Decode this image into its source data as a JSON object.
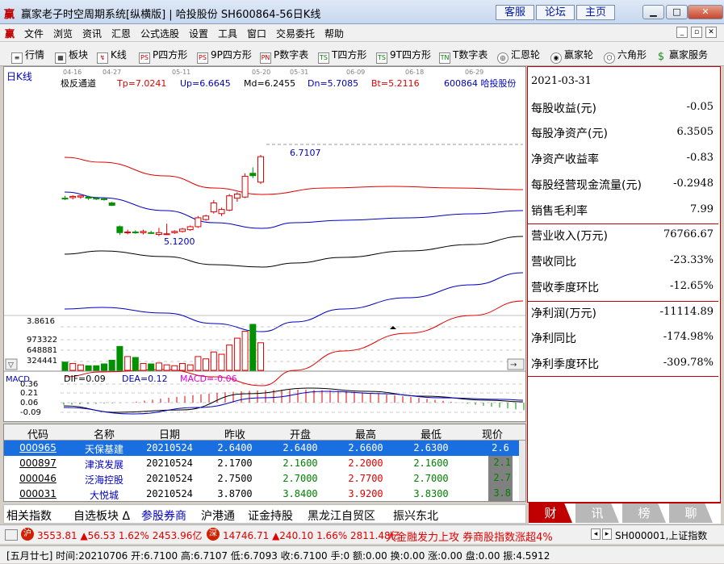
{
  "window": {
    "title": "赢家老子时空周期系统[纵横版] | 哈投股份  SH600864-56日K线",
    "buttons": [
      "客服",
      "论坛",
      "主页"
    ]
  },
  "menu": [
    "文件",
    "浏览",
    "资讯",
    "汇恩",
    "公式选股",
    "设置",
    "工具",
    "窗口",
    "交易委托",
    "帮助"
  ],
  "toolbar": [
    "行情",
    "板块",
    "K线",
    "P四方形",
    "9P四方形",
    "P数字表",
    "T四方形",
    "9T四方形",
    "T数字表",
    "汇恩轮",
    "赢家轮",
    "六角形",
    "赢家服务"
  ],
  "chart": {
    "label": "日K线",
    "indicator": "极反通道",
    "tp": "Tp=7.0241",
    "up": "Up=6.6645",
    "md": "Md=6.2455",
    "dn": "Dn=5.7085",
    "bt": "Bt=5.2116",
    "stock": "600864  哈投股份",
    "dates": [
      "04-16",
      "04-27",
      "05-11",
      "05-20",
      "05-31",
      "06-09",
      "06-18",
      "06-29"
    ],
    "label_high": "6.7107",
    "label_low": "5.1200",
    "vol_labels": [
      "3.8616",
      "973322",
      "648881",
      "324441"
    ],
    "macd": {
      "name": "MACD",
      "dif": "DIF=0.09",
      "dea": "DEA=0.12",
      "macd": "MACD=-0.06",
      "ticks": [
        "0.36",
        "0.21",
        "0.06",
        "-0.09"
      ]
    },
    "candles": [
      {
        "o": 5.98,
        "h": 6.02,
        "l": 5.95,
        "c": 5.97
      },
      {
        "o": 5.99,
        "h": 6.03,
        "l": 5.96,
        "c": 6.01
      },
      {
        "o": 6.0,
        "h": 6.03,
        "l": 5.97,
        "c": 6.02
      },
      {
        "o": 6.0,
        "h": 6.02,
        "l": 5.95,
        "c": 5.98
      },
      {
        "o": 5.98,
        "h": 6.0,
        "l": 5.95,
        "c": 5.97
      },
      {
        "o": 5.97,
        "h": 5.99,
        "l": 5.94,
        "c": 5.96
      },
      {
        "o": 5.9,
        "h": 5.92,
        "l": 5.85,
        "c": 5.86
      },
      {
        "o": 5.5,
        "h": 5.52,
        "l": 5.36,
        "c": 5.4
      },
      {
        "o": 5.4,
        "h": 5.45,
        "l": 5.37,
        "c": 5.41
      },
      {
        "o": 5.41,
        "h": 5.44,
        "l": 5.38,
        "c": 5.4
      },
      {
        "o": 5.4,
        "h": 5.45,
        "l": 5.37,
        "c": 5.42
      },
      {
        "o": 5.4,
        "h": 5.43,
        "l": 5.38,
        "c": 5.39
      },
      {
        "o": 5.37,
        "h": 5.48,
        "l": 5.34,
        "c": 5.4
      },
      {
        "o": 5.37,
        "h": 5.55,
        "l": 5.36,
        "c": 5.38
      },
      {
        "o": 5.4,
        "h": 5.44,
        "l": 5.38,
        "c": 5.42
      },
      {
        "o": 5.42,
        "h": 5.48,
        "l": 5.4,
        "c": 5.46
      },
      {
        "o": 5.45,
        "h": 5.52,
        "l": 5.43,
        "c": 5.5
      },
      {
        "o": 5.5,
        "h": 5.68,
        "l": 5.48,
        "c": 5.65
      },
      {
        "o": 5.62,
        "h": 5.7,
        "l": 5.6,
        "c": 5.68
      },
      {
        "o": 5.75,
        "h": 5.95,
        "l": 5.72,
        "c": 5.9
      },
      {
        "o": 5.72,
        "h": 5.82,
        "l": 5.68,
        "c": 5.79
      },
      {
        "o": 5.78,
        "h": 6.05,
        "l": 5.76,
        "c": 6.02
      },
      {
        "o": 5.98,
        "h": 6.08,
        "l": 5.92,
        "c": 6.05
      },
      {
        "o": 6.0,
        "h": 6.4,
        "l": 5.98,
        "c": 6.35
      },
      {
        "o": 6.4,
        "h": 6.5,
        "l": 6.32,
        "c": 6.36
      },
      {
        "o": 6.25,
        "h": 6.71,
        "l": 6.22,
        "c": 6.68
      }
    ],
    "volumes": [
      0.18,
      0.15,
      0.12,
      0.1,
      0.1,
      0.14,
      0.22,
      0.52,
      0.3,
      0.28,
      0.15,
      0.14,
      0.16,
      0.12,
      0.1,
      0.15,
      0.12,
      0.3,
      0.25,
      0.4,
      0.35,
      0.55,
      0.7,
      0.85,
      1.0,
      0.6
    ]
  },
  "finance": [
    {
      "k": "2021-03-31",
      "v": ""
    },
    {
      "k": "每股收益(元)",
      "v": "-0.05"
    },
    {
      "k": "每股净资产(元)",
      "v": "6.3505"
    },
    {
      "k": "净资产收益率",
      "v": "-0.83"
    },
    {
      "k": "每股经营现金流量(元)",
      "v": "-0.2948"
    },
    {
      "k": "销售毛利率",
      "v": "7.99"
    },
    {
      "k": "营业收入(万元)",
      "v": "76766.67"
    },
    {
      "k": "营收同比",
      "v": "-23.33%"
    },
    {
      "k": "营收季度环比",
      "v": "-12.65%"
    },
    {
      "k": "净利润(万元)",
      "v": "-11114.89"
    },
    {
      "k": "净利同比",
      "v": "-174.98%"
    },
    {
      "k": "净利季度环比",
      "v": "-309.78%"
    }
  ],
  "right_tabs": [
    "财",
    "讯",
    "榜",
    "聊"
  ],
  "table": {
    "headers": [
      "代码",
      "名称",
      "日期",
      "昨收",
      "开盘",
      "最高",
      "最低",
      "现价"
    ],
    "rows": [
      {
        "code": "000965",
        "name": "天保基建",
        "date": "20210524",
        "prev": "2.6400",
        "open": "2.6400",
        "high": "2.6600",
        "low": "2.6300",
        "cur": "2.6"
      },
      {
        "code": "000897",
        "name": "津滨发展",
        "date": "20210524",
        "prev": "2.1700",
        "open": "2.1600",
        "high": "2.2000",
        "low": "2.1600",
        "cur": "2.1"
      },
      {
        "code": "000046",
        "name": "泛海控股",
        "date": "20210524",
        "prev": "2.7500",
        "open": "2.7000",
        "high": "2.7700",
        "low": "2.7000",
        "cur": "2.7"
      },
      {
        "code": "000031",
        "name": "大悦城",
        "date": "20210524",
        "prev": "3.8700",
        "open": "3.8400",
        "high": "3.9200",
        "low": "3.8300",
        "cur": "3.8"
      }
    ]
  },
  "sectors": [
    "相关指数",
    "自选板块 Δ",
    "参股券商",
    "沪港通",
    "证金持股",
    "黑龙江自贸区",
    "振兴东北"
  ],
  "status1": {
    "sh": "3553.81 ▲56.53 1.62% 2453.96亿",
    "sz": "14746.71 ▲240.10 1.66% 2811.48亿",
    "news": "大金融发力上攻 券商股指数涨超4%",
    "code": "SH000001,上证指数"
  },
  "status2": "[五月廿七] 时间:20210706 开:6.7100 高:6.7107 低:6.7093 收:6.7100 手:0 额:0.00 换:0.00 涨:0.00 盘:0.00 振:4.5912",
  "colors": {
    "up": "#e00000",
    "down": "#009000",
    "blue": "#0000c0",
    "brand": "#c00000"
  }
}
